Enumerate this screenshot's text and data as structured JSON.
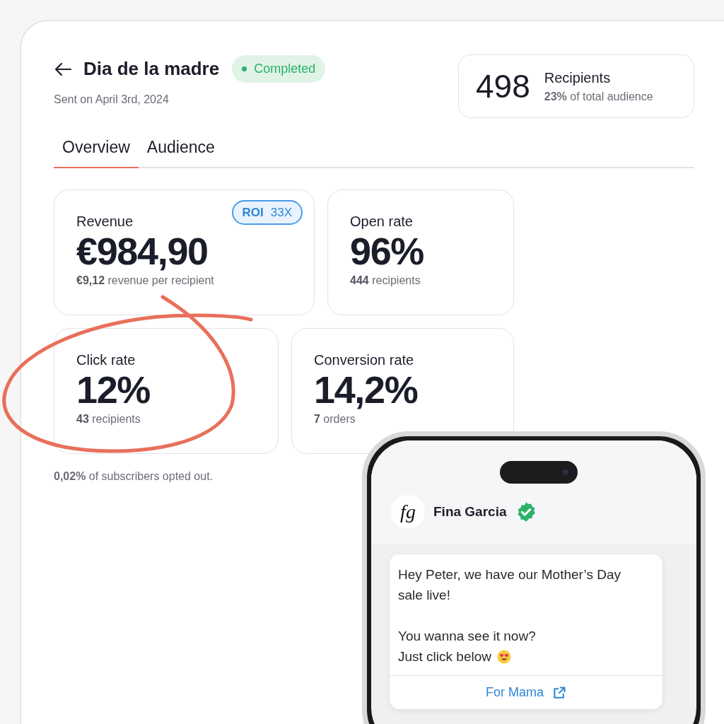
{
  "header": {
    "title": "Dia de la madre",
    "status": "Completed",
    "sent": "Sent on April 3rd, 2024"
  },
  "recipients": {
    "count": "498",
    "label": "Recipients",
    "share": "**23%** of total audience"
  },
  "tabs": [
    {
      "label": "Overview",
      "selected": true
    },
    {
      "label": "Audience",
      "selected": false
    }
  ],
  "metrics": [
    {
      "label": "Revenue",
      "value": "€984,90",
      "detail": "**€9,12** revenue per recipient",
      "badge": {
        "key": "ROI",
        "value": "33X"
      }
    },
    {
      "label": "Open rate",
      "value": "96%",
      "detail": "**444** recipients"
    },
    {
      "label": "Click rate",
      "value": "12%",
      "detail": "**43** recipients",
      "circled": true
    },
    {
      "label": "Conversion rate",
      "value": "14,2%",
      "detail": "**7** orders"
    }
  ],
  "opt_out": "**0,02%** of subscribers opted out.",
  "phone": {
    "logo": "fg",
    "sender": "Fina Garcia",
    "verified": true,
    "message": [
      "Hey Peter, we have our Mother’s Day sale live!",
      "You wanna see it now?",
      "Just click below"
    ],
    "emoji_after_last_line": true,
    "button": "For Mama"
  }
}
